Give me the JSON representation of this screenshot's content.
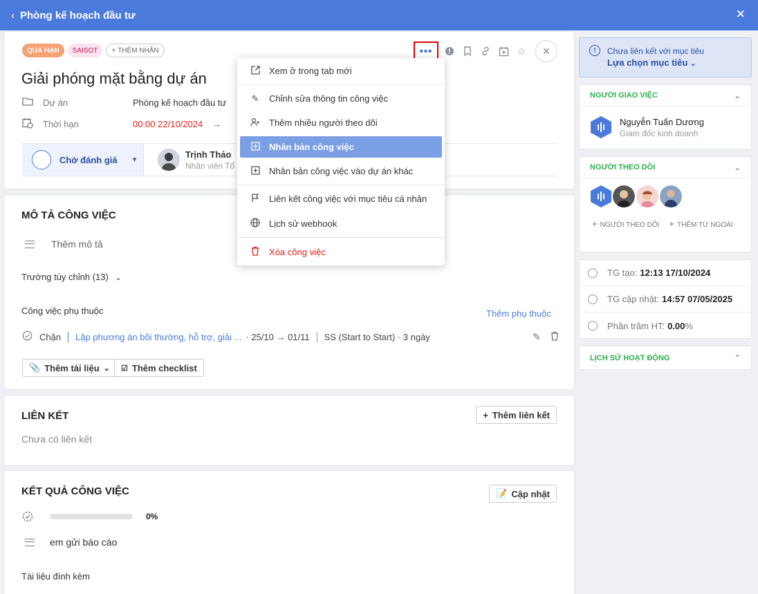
{
  "topbar": {
    "title": "Phòng kế hoạch đầu tư"
  },
  "tags": [
    "QUÁ HẠN",
    "SAISOT",
    "THÊM NHÃN"
  ],
  "task": {
    "title": "Giải phóng mặt bằng dự án",
    "project_label": "Dự án",
    "project_value": "Phòng kế hoạch đầu tư",
    "deadline_label": "Thời hạn",
    "deadline_value": "00:00 22/10/2024",
    "status": "Chờ đánh giá",
    "assignee_name": "Trịnh Thảo",
    "assignee_role": "Nhân viên Tổ c"
  },
  "menu": {
    "items": [
      "Xem ở trong tab mới",
      "Chỉnh sửa thông tin công việc",
      "Thêm nhiều người theo dõi",
      "Nhân bản công việc",
      "Nhân bản công việc vào dự án khác",
      "Liên kết công việc với mục tiêu cá nhân",
      "Lịch sử webhook",
      "Xóa công việc"
    ]
  },
  "description": {
    "title": "MÔ TẢ CÔNG VIỆC",
    "placeholder": "Thêm mô tả",
    "custom_fields": "Trường tùy chỉnh (13)",
    "dependencies_title": "Công việc phụ thuộc",
    "add_dependency": "Thêm phụ thuộc",
    "dep_type": "Chặn",
    "dep_task": "Lập phương án bồi thường, hỗ trợ, giải ...",
    "dep_dates": "· 25/10 → 01/11",
    "dep_relation": "SS (Start to Start) · 3 ngày",
    "add_doc": "Thêm tài liệu",
    "add_checklist": "Thêm checklist"
  },
  "links": {
    "title": "LIÊN KẾT",
    "add": "Thêm liên kết",
    "empty": "Chưa có liên kết"
  },
  "result": {
    "title": "KẾT QUẢ CÔNG VIỆC",
    "update": "Cập nhật",
    "progress_text": "0%",
    "progress_value": 0,
    "report": "em gửi báo cáo",
    "attachments": "Tài liệu đính kèm"
  },
  "sidebar": {
    "goal_notice": "Chưa liên kết với mục tiêu",
    "goal_select": "Lựa chọn mục tiêu",
    "assigner_title": "NGƯỜI GIAO VIỆC",
    "assigner_name": "Nguyễn Tuấn Dương",
    "assigner_role": "Giám đốc kinh doanh",
    "followers_title": "NGƯỜI THEO DÕI",
    "add_follower": "NGƯỜI THEO DÕI",
    "add_external": "THÊM TỪ NGOÀI",
    "created_label": "TG tạo:",
    "created_value": "12:13 17/10/2024",
    "updated_label": "TG cập nhật:",
    "updated_value": "14:57 07/05/2025",
    "percent_label": "Phần trăm HT:",
    "percent_value": "0.00",
    "percent_unit": "%",
    "activity_title": "LỊCH SỬ HOẠT ĐỘNG"
  },
  "colors": {
    "primary": "#4a7bdc",
    "danger": "#e0201a",
    "success": "#2eaf4d",
    "menu_active": "#7b9fe5"
  }
}
